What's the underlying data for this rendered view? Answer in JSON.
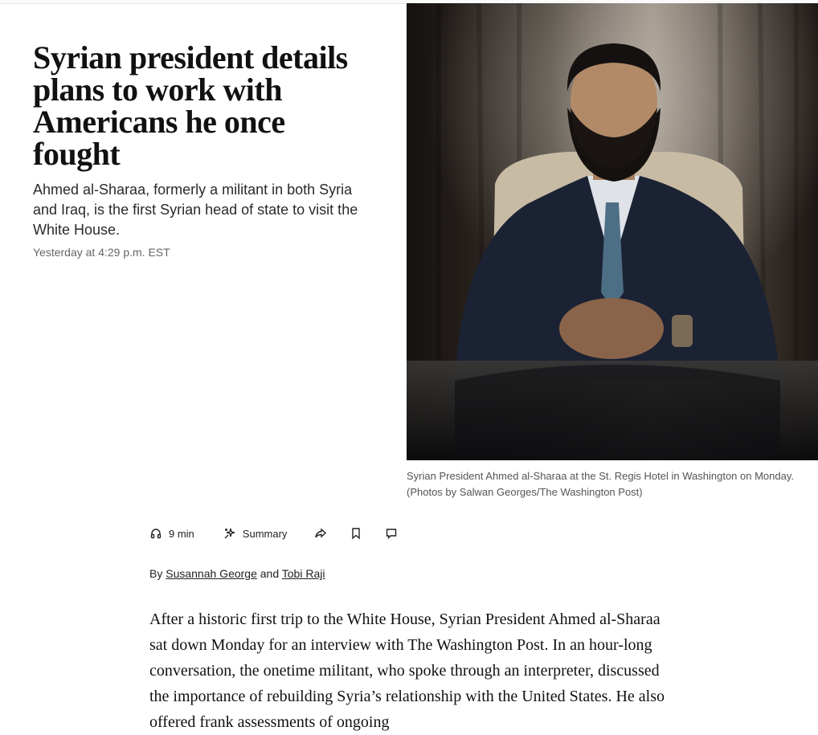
{
  "article": {
    "headline": "Syrian president details plans to work with Americans he once fought",
    "dek": "Ahmed al-Sharaa, formerly a militant in both Syria and Iraq, is the first Syrian head of state to visit the White House.",
    "timestamp": "Yesterday at 4:29 p.m. EST",
    "caption_line1": "Syrian President Ahmed al-Sharaa at the St. Regis Hotel in Washington on Monday.",
    "caption_line2": "(Photos by Salwan Georges/The Washington Post)",
    "byline": {
      "prefix": "By",
      "author1": "Susannah George",
      "joiner": "and",
      "author2": "Tobi Raji"
    },
    "body": "After a historic first trip to the White House, Syrian President Ahmed al-Sharaa sat down Monday for an interview with The Washington Post. In an hour-long conversation, the onetime militant, who spoke through an interpreter, discussed the importance of rebuilding Syria’s relationship with the United States. He also offered frank assessments of ongoing"
  },
  "toolbar": {
    "listen_label": "9 min",
    "summary_label": "Summary",
    "icons": [
      "headphones-icon",
      "sparkle-icon",
      "share-icon",
      "bookmark-icon",
      "comment-icon"
    ]
  },
  "colors": {
    "text": "#111111",
    "meta": "#666666",
    "photo_bg": "#1a1614"
  }
}
